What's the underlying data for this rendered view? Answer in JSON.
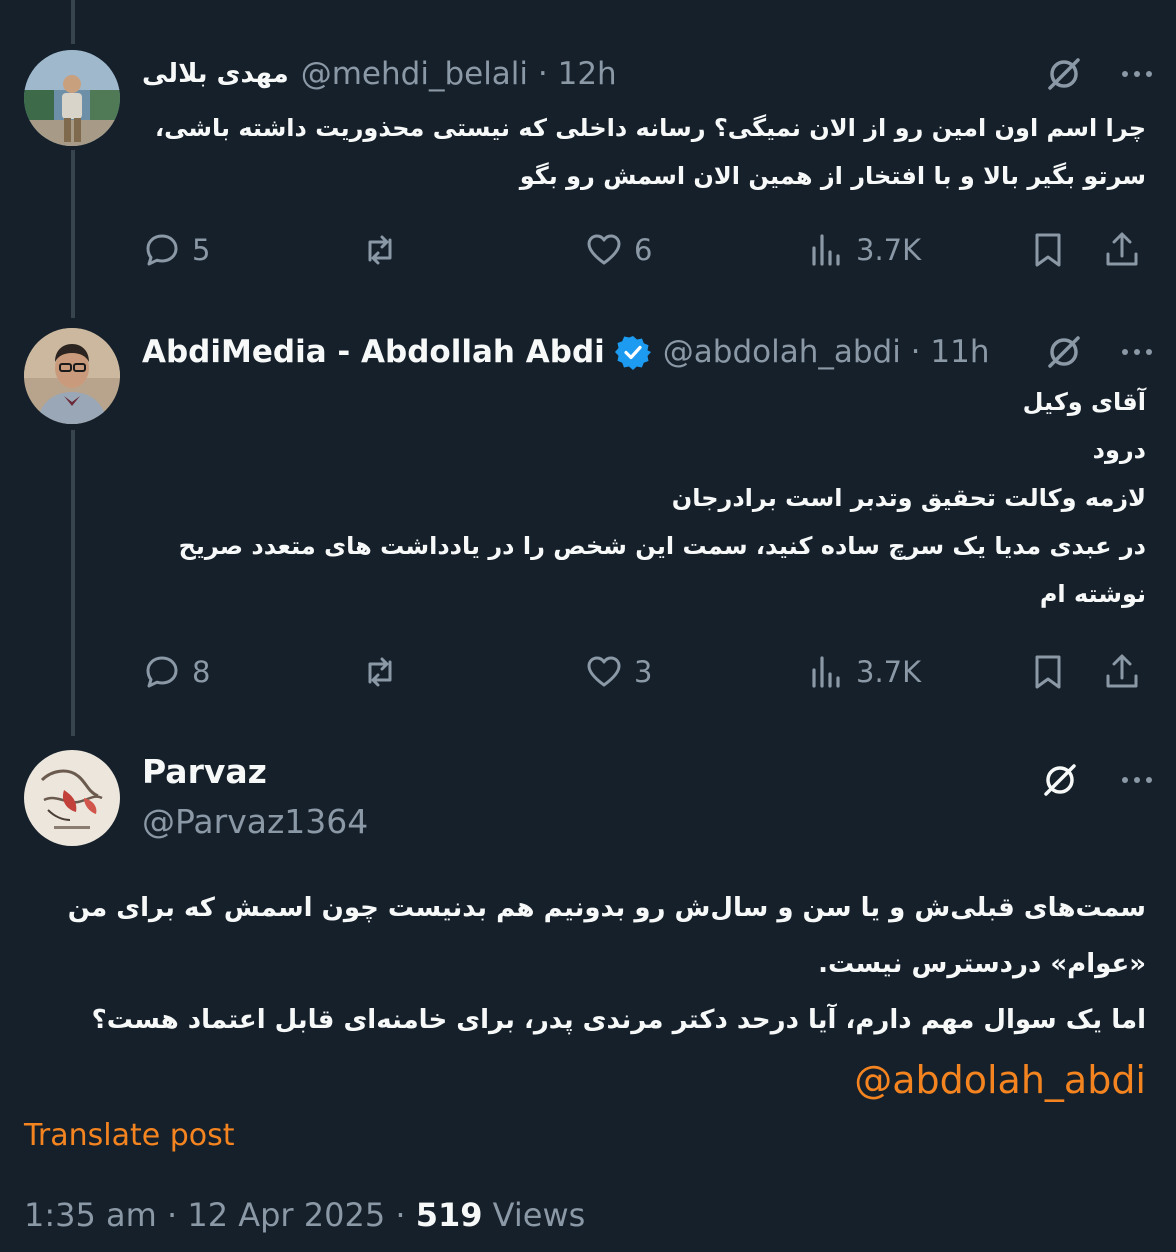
{
  "tweets": [
    {
      "name": "مهدی بلالی",
      "handle": "@mehdi_belali",
      "time": "12h",
      "text_lines": [
        "چرا اسم اون امین رو از الان نمیگی؟ رسانه داخلی که نیستی محذوریت داشته باشی،",
        "سرتو بگیر بالا و با افتخار از همین الان اسمش رو بگو"
      ],
      "replies": "5",
      "likes": "6",
      "views": "3.7K"
    },
    {
      "name": "AbdiMedia - Abdollah Abdi",
      "handle": "@abdolah_abdi",
      "time": "11h",
      "verified": true,
      "text_lines": [
        "آقای وکیل",
        "درود",
        "لازمه وکالت تحقیق وتدبر است برادرجان",
        "در عبدی مدیا یک سرچ ساده کنید، سمت این شخص را در یادداشت های متعدد صریح",
        "نوشته ام"
      ],
      "replies": "8",
      "likes": "3",
      "views": "3.7K"
    }
  ],
  "main_tweet": {
    "name": "Parvaz",
    "handle": "@Parvaz1364",
    "text_lines": [
      "سمت‌های قبلی‌ش و یا سن و سال‌ش رو بدونیم هم بدنیست چون اسمش که برای من",
      "«عوام» دردسترس نیست.",
      "اما یک سوال مهم دارم،  آیا درحد دکتر مرندی پدر، برای خامنه‌ای قابل اعتماد هست؟"
    ],
    "mention": "@abdolah_abdi",
    "translate_label": "Translate post",
    "time": "1:35 am",
    "date": "12 Apr 2025",
    "views_count": "519",
    "views_label": "Views"
  },
  "meta_separator": "·",
  "colors": {
    "background": "#15202b",
    "text": "#f7f9f9",
    "muted": "#8b98a5",
    "accent": "#f4841f",
    "verified": "#1d9bf0"
  },
  "icons": [
    "grok-icon",
    "more-icon",
    "reply-icon",
    "retweet-icon",
    "like-icon",
    "views-icon",
    "bookmark-icon",
    "share-icon",
    "verified-badge-icon"
  ]
}
